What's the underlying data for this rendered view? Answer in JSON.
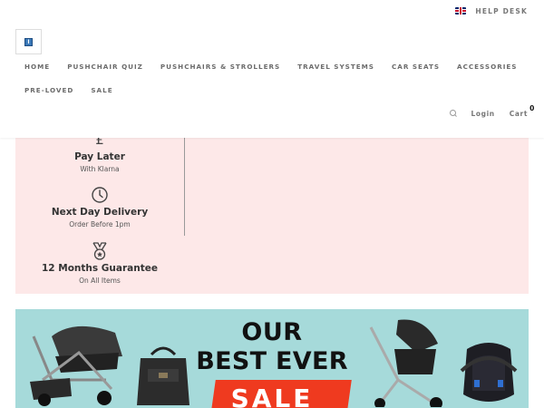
{
  "topbar": {
    "language_flag": "uk-flag-icon",
    "help_desk_label": "HELP DESK"
  },
  "logo": {
    "icon": "store-logo-icon",
    "mark_text": "I"
  },
  "nav": {
    "row1": [
      {
        "label": "HOME"
      },
      {
        "label": "PUSHCHAIR QUIZ"
      },
      {
        "label": "PUSHCHAIRS & STROLLERS"
      },
      {
        "label": "TRAVEL SYSTEMS"
      },
      {
        "label": "CAR SEATS"
      },
      {
        "label": "ACCESSORIES"
      }
    ],
    "row2": [
      {
        "label": "PRE-LOVED"
      },
      {
        "label": "SALE"
      }
    ]
  },
  "utility": {
    "search_icon": "search-icon",
    "login_label": "Login",
    "cart_label": "Cart",
    "cart_count": "0"
  },
  "features": [
    {
      "icon": "pound-icon",
      "glyph": "£",
      "title": "Pay Later",
      "subtitle": "With Klarna"
    },
    {
      "icon": "clock-icon",
      "title": "Next Day Delivery",
      "subtitle": "Order Before 1pm"
    },
    {
      "icon": "medal-icon",
      "title": "12 Months Guarantee",
      "subtitle": "On All Items"
    }
  ],
  "banner": {
    "line1": "OUR",
    "line2": "BEST EVER",
    "line3": "SALE"
  },
  "colors": {
    "promo_background": "#fde8e8",
    "banner_background": "#a6dada",
    "sale_red": "#ef3a1f"
  }
}
